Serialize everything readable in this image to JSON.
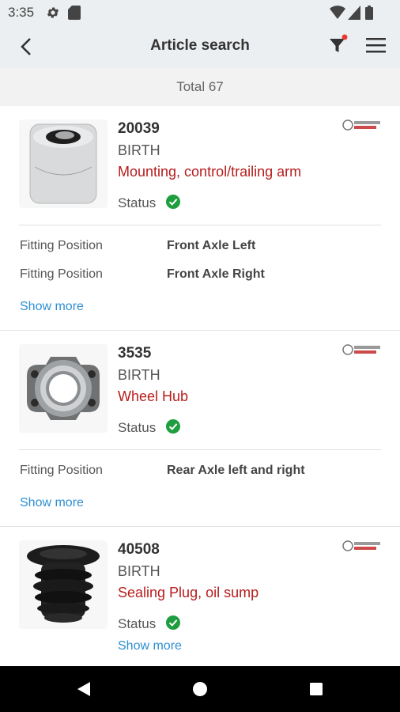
{
  "status_bar": {
    "time": "3:35",
    "icons": [
      "gear-icon",
      "sd-card-icon",
      "wifi-icon",
      "signal-icon",
      "battery-icon"
    ]
  },
  "app_bar": {
    "title": "Article search",
    "icons": [
      "back-arrow-icon",
      "filter-icon",
      "menu-icon"
    ],
    "filter_dot_color": "#e53935"
  },
  "total": "Total 67",
  "articles": [
    {
      "number": "20039",
      "brand": "BIRTH",
      "description": "Mounting, control/trailing arm",
      "status_label": "Status",
      "status_icon": "check-circle-icon",
      "fitting_positions": [
        {
          "label": "Fitting Position",
          "value": "Front Axle Left"
        },
        {
          "label": "Fitting Position",
          "value": "Front Axle Right"
        }
      ],
      "show_more": "Show more"
    },
    {
      "number": "3535",
      "brand": "BIRTH",
      "description": "Wheel Hub",
      "status_label": "Status",
      "status_icon": "check-circle-icon",
      "fitting_positions": [
        {
          "label": "Fitting Position",
          "value": "Rear Axle left and right"
        }
      ],
      "show_more": "Show more"
    },
    {
      "number": "40508",
      "brand": "BIRTH",
      "description": "Sealing Plug, oil sump",
      "status_label": "Status",
      "status_icon": "check-circle-icon",
      "fitting_positions": [],
      "show_more": "Show more"
    }
  ],
  "colors": {
    "accent_red": "#b71c1c",
    "link_blue": "#2f8fd3",
    "status_green": "#1e9e3e",
    "bar_bg": "#eceff1"
  },
  "nav_bar": {
    "icons": [
      "back-triangle-icon",
      "home-circle-icon",
      "recents-square-icon"
    ]
  }
}
